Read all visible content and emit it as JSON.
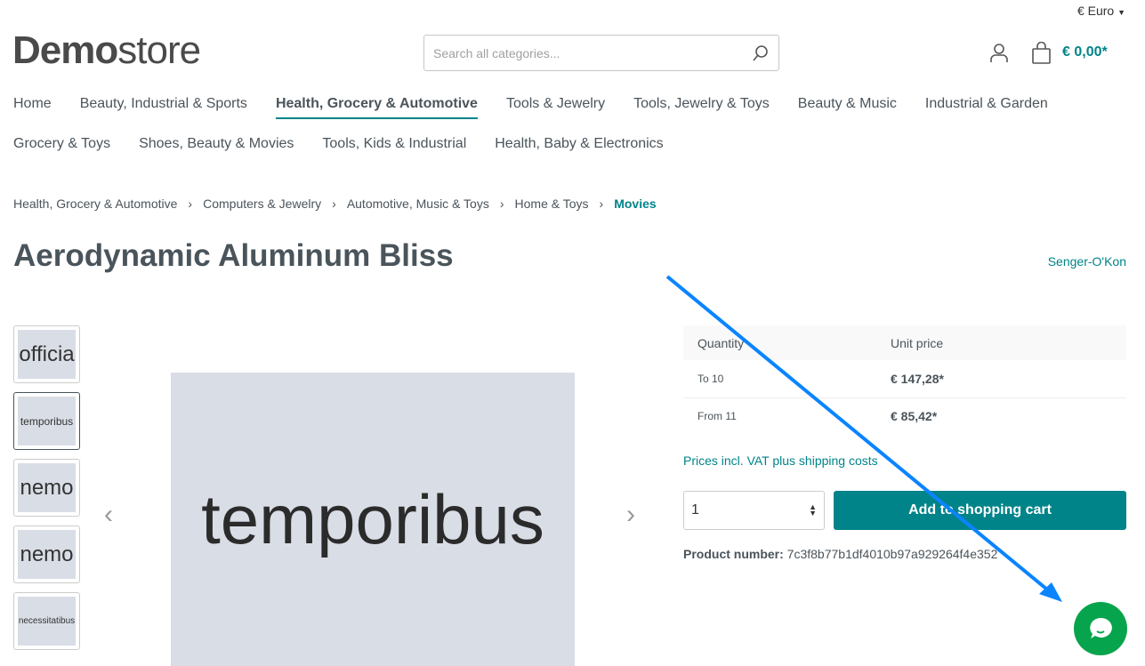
{
  "header": {
    "currency": "€ Euro",
    "logo_bold": "Demo",
    "logo_light": "store",
    "search_placeholder": "Search all categories...",
    "cart_total": "€ 0,00*"
  },
  "nav": {
    "row1": [
      "Home",
      "Beauty, Industrial & Sports",
      "Health, Grocery & Automotive",
      "Tools & Jewelry",
      "Tools, Jewelry & Toys",
      "Beauty & Music",
      "Industrial & Garden"
    ],
    "row2": [
      "Grocery & Toys",
      "Shoes, Beauty & Movies",
      "Tools, Kids & Industrial",
      "Health, Baby & Electronics"
    ],
    "active": "Health, Grocery & Automotive"
  },
  "breadcrumb": [
    "Health, Grocery & Automotive",
    "Computers & Jewelry",
    "Automotive, Music & Toys",
    "Home & Toys",
    "Movies"
  ],
  "product": {
    "title": "Aerodynamic Aluminum Bliss",
    "manufacturer": "Senger-O'Kon",
    "thumbs": [
      "officia",
      "temporibus",
      "nemo",
      "nemo",
      "necessitatibus"
    ],
    "main_image": "temporibus",
    "price_table": {
      "headers": [
        "Quantity",
        "Unit price"
      ],
      "rows": [
        [
          "To 10",
          "€ 147,28*"
        ],
        [
          "From 11",
          "€ 85,42*"
        ]
      ]
    },
    "vat_note": "Prices incl. VAT plus shipping costs",
    "quantity": "1",
    "add_to_cart": "Add to shopping cart",
    "product_number_label": "Product number:",
    "product_number": "7c3f8b77b1df4010b97a929264f4e352"
  },
  "colors": {
    "accent": "#008489",
    "chat": "#06a44c",
    "annotation_arrow": "#0a84ff"
  }
}
